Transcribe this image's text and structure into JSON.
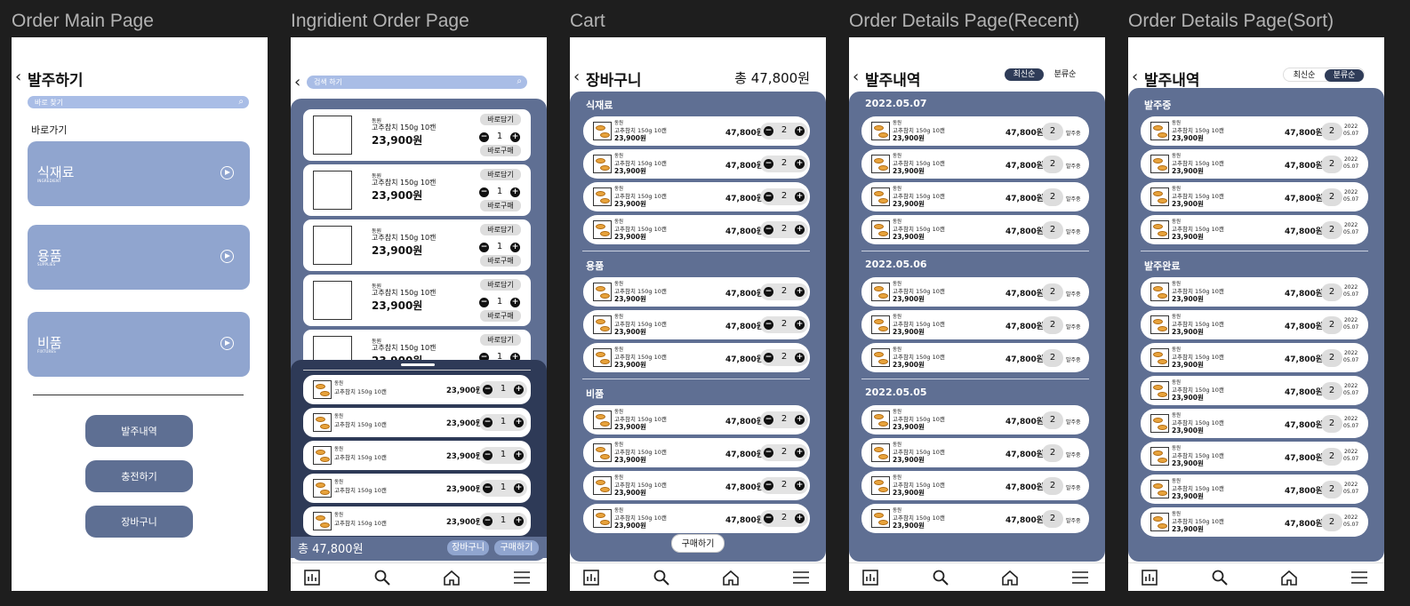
{
  "frames": {
    "main": "Order Main Page",
    "ingredient": "Ingridient Order Page",
    "cart": "Cart",
    "recent": "Order Details Page(Recent)",
    "sort": "Order Details Page(Sort)"
  },
  "main_page": {
    "title": "발주하기",
    "search_placeholder": "바로 찾기",
    "shortcut_label": "바로가기",
    "categories": [
      {
        "label": "식재료",
        "sub": "INGREDIENT"
      },
      {
        "label": "용품",
        "sub": "SUPPLIES"
      },
      {
        "label": "비품",
        "sub": "FIXTURES"
      }
    ],
    "buttons": [
      "발주내역",
      "충전하기",
      "장바구니"
    ]
  },
  "ingredient_page": {
    "search_placeholder": "검색 하기",
    "product": {
      "brand": "동원",
      "name": "고추참치 150g 10캔",
      "price": "23,900원",
      "qty": "1",
      "add_cart": "바로담기",
      "buy_now": "바로구매"
    },
    "sheet_price": "23,900원",
    "total": "총 47,800원",
    "cart_btn": "장바구니",
    "buy_btn": "구매하기"
  },
  "cart_page": {
    "title": "장바구니",
    "total": "총 47,800원",
    "sections": [
      "식재료",
      "용품",
      "비품"
    ],
    "item": {
      "brand": "동원",
      "name": "고추참치 150g 10캔",
      "price": "23,900원",
      "amount": "47,800원",
      "qty": "2"
    },
    "buy_btn": "구매하기"
  },
  "recent_page": {
    "title": "발주내역",
    "sort_recent": "최신순",
    "sort_category": "분류순",
    "dates": [
      "2022.05.07",
      "2022.05.06",
      "2022.05.05"
    ],
    "status": "발주중"
  },
  "sort_page": {
    "title": "발주내역",
    "sections": [
      "발주중",
      "발주완료"
    ],
    "date_year": "2022",
    "date_md": "05.07"
  }
}
